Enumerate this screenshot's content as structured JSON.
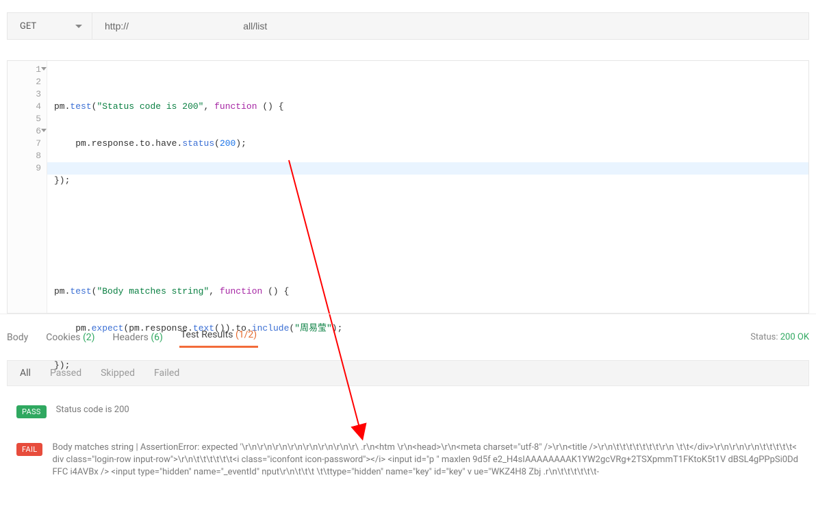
{
  "request": {
    "method": "GET",
    "url": "http://                                           all/list"
  },
  "editor": {
    "lines": {
      "l1": [
        "pm",
        ".",
        "test",
        "(",
        "\"Status code is 200\"",
        ", ",
        "function",
        " () {"
      ],
      "l2": [
        "    pm",
        ".",
        "response",
        ".",
        "to",
        ".",
        "have",
        ".",
        "status",
        "(",
        "200",
        ");"
      ],
      "l3": [
        "});"
      ],
      "l6": [
        "pm",
        ".",
        "test",
        "(",
        "\"Body matches string\"",
        ", ",
        "function",
        " () {"
      ],
      "l7": [
        "    pm",
        ".",
        "expect",
        "(",
        "pm",
        ".",
        "response",
        ".",
        "text",
        "()).",
        "to",
        ".",
        "include",
        "(",
        "\"周易莹\"",
        ");"
      ],
      "l8": [
        "});"
      ]
    },
    "cursor_line": 9
  },
  "tabs": {
    "body": "Body",
    "cookies": "Cookies",
    "cookies_count": "(2)",
    "headers": "Headers",
    "headers_count": "(6)",
    "tests": "Test Results",
    "tests_count": "(1/2)"
  },
  "status": {
    "label": "Status:",
    "value": "200 OK"
  },
  "filters": {
    "all": "All",
    "passed": "Passed",
    "skipped": "Skipped",
    "failed": "Failed"
  },
  "results": {
    "pass_badge": "PASS",
    "fail_badge": "FAIL",
    "pass_msg": "Status code is 200",
    "fail_msg": "Body matches string | AssertionError: expected '\\r\\n\\r\\n\\r\\n\\r\\n\\r\\n\\r\\n\\r\\n\\r\\                                                                .r\\n<htm    \\r\\n<head>\\r\\n<meta charset=\"utf-8\"  />\\r\\n<title />\\r\\n\\t\\t\\t\\t\\t\\t\\t\\r\\n         \\t\\t</div>\\r\\n\\r\\n\\r\\n\\t\\t\\t\\t\\t<div class=\"login-row input-row\">\\r\\n\\t\\t\\t\\t\\t\\t<i class=\"iconfont icon-password\"></i> <input id=\"p                         \" maxlen 9d5f             e2_H4sIAAAAAAAAK1YW2gcVRg+2TSXpmmT1FKtoK5t1V                                                                                            dBSL4gPPpSi0DdFFC        i4AVBx /> <input type=\"hidden\" name=\"_eventId\"                                nput\\r\\n\\t\\t\\t     \\t\\ttype=\"hidden\" name=\"key\" id=\"key\" v   ue=\"WKZ4H8                    Zbj     .r\\n\\t\\t\\t\\t\\t\\t-"
  }
}
